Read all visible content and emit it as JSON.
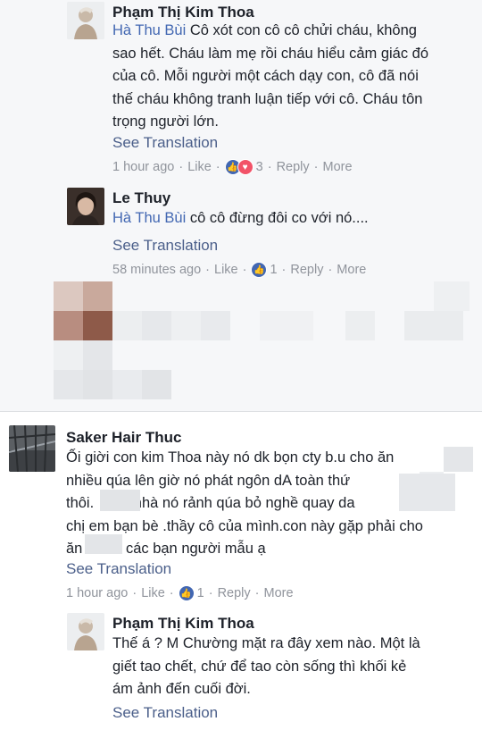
{
  "comments": [
    {
      "author": "Phạm Thị Kim Thoa",
      "mention": "Hà Thu Bùi",
      "lines": [
        " Cô xót con cô cô chửi cháu, không",
        "sao hết. Cháu làm mẹ rồi cháu hiểu cảm giác đó",
        "của cô. Mỗi người một cách dạy con, cô đã nói",
        "thế cháu không tranh luận tiếp với cô. Cháu tôn",
        "trọng người lớn."
      ],
      "see_translation": "See Translation",
      "time": "1 hour ago",
      "like": "Like",
      "reaction_count": "3",
      "reply": "Reply",
      "more": "More"
    },
    {
      "author": "Le Thuy",
      "mention": "Hà Thu Bùi",
      "lines": [
        " cô cô đừng đôi co với nó...."
      ],
      "see_translation": "See Translation",
      "time": "58 minutes ago",
      "like": "Like",
      "reaction_count": "1",
      "reply": "Reply",
      "more": "More"
    },
    {
      "author": "Saker Hair Thuc",
      "lines": [
        "Ối giời con kim Thoa này nó dk bọn cty b.u cho ăn",
        "nhiều qúa lên giờ nó phát ngôn dA toàn thứ ",
        "thôi.",
        " nhà nó rảnh qúa bỏ nghề quay da ",
        "chị em bạn bè .thầy cô của mình.con này gặp phải cho",
        "ăn",
        " các bạn người mẫu ạ"
      ],
      "see_translation": "See Translation",
      "time": "1 hour ago",
      "like": "Like",
      "reaction_count": "1",
      "reply": "Reply",
      "more": "More"
    },
    {
      "author": "Phạm Thị Kim Thoa",
      "lines": [
        "Thế á ? M Chường mặt ra đây xem nào. Một là",
        "giết tao chết, chứ để tao còn sống thì khối kẻ",
        "ám ảnh đến cuối đời."
      ],
      "see_translation": "See Translation"
    }
  ],
  "icons": {
    "like_reaction": "like-icon",
    "love_reaction": "heart-icon"
  },
  "colors": {
    "link": "#4b5f8a",
    "mention": "#4267b2",
    "meta": "#90949c",
    "like": "#4267b2",
    "love": "#f25268"
  }
}
